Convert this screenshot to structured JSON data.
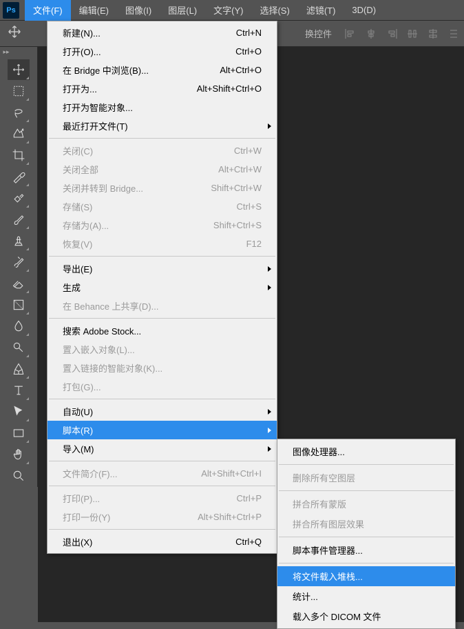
{
  "app_icon": "Ps",
  "menubar": {
    "items": [
      {
        "label": "文件(F)",
        "active": true
      },
      {
        "label": "编辑(E)"
      },
      {
        "label": "图像(I)"
      },
      {
        "label": "图层(L)"
      },
      {
        "label": "文字(Y)"
      },
      {
        "label": "选择(S)"
      },
      {
        "label": "滤镜(T)"
      },
      {
        "label": "3D(D)"
      }
    ]
  },
  "options": {
    "transform_label": "换控件"
  },
  "file_menu": {
    "groups": [
      [
        {
          "label": "新建(N)...",
          "shortcut": "Ctrl+N"
        },
        {
          "label": "打开(O)...",
          "shortcut": "Ctrl+O"
        },
        {
          "label": "在 Bridge 中浏览(B)...",
          "shortcut": "Alt+Ctrl+O"
        },
        {
          "label": "打开为...",
          "shortcut": "Alt+Shift+Ctrl+O"
        },
        {
          "label": "打开为智能对象..."
        },
        {
          "label": "最近打开文件(T)",
          "submenu": true
        }
      ],
      [
        {
          "label": "关闭(C)",
          "shortcut": "Ctrl+W",
          "disabled": true
        },
        {
          "label": "关闭全部",
          "shortcut": "Alt+Ctrl+W",
          "disabled": true
        },
        {
          "label": "关闭并转到 Bridge...",
          "shortcut": "Shift+Ctrl+W",
          "disabled": true
        },
        {
          "label": "存储(S)",
          "shortcut": "Ctrl+S",
          "disabled": true
        },
        {
          "label": "存储为(A)...",
          "shortcut": "Shift+Ctrl+S",
          "disabled": true
        },
        {
          "label": "恢复(V)",
          "shortcut": "F12",
          "disabled": true
        }
      ],
      [
        {
          "label": "导出(E)",
          "submenu": true
        },
        {
          "label": "生成",
          "submenu": true
        },
        {
          "label": "在 Behance 上共享(D)...",
          "disabled": true
        }
      ],
      [
        {
          "label": "搜索 Adobe Stock..."
        },
        {
          "label": "置入嵌入对象(L)...",
          "disabled": true
        },
        {
          "label": "置入链接的智能对象(K)...",
          "disabled": true
        },
        {
          "label": "打包(G)...",
          "disabled": true
        }
      ],
      [
        {
          "label": "自动(U)",
          "submenu": true
        },
        {
          "label": "脚本(R)",
          "submenu": true,
          "highlight": true
        },
        {
          "label": "导入(M)",
          "submenu": true
        }
      ],
      [
        {
          "label": "文件简介(F)...",
          "shortcut": "Alt+Shift+Ctrl+I",
          "disabled": true
        }
      ],
      [
        {
          "label": "打印(P)...",
          "shortcut": "Ctrl+P",
          "disabled": true
        },
        {
          "label": "打印一份(Y)",
          "shortcut": "Alt+Shift+Ctrl+P",
          "disabled": true
        }
      ],
      [
        {
          "label": "退出(X)",
          "shortcut": "Ctrl+Q"
        }
      ]
    ]
  },
  "script_submenu": {
    "groups": [
      [
        {
          "label": "图像处理器..."
        }
      ],
      [
        {
          "label": "删除所有空图层",
          "disabled": true
        }
      ],
      [
        {
          "label": "拼合所有蒙版",
          "disabled": true
        },
        {
          "label": "拼合所有图层效果",
          "disabled": true
        }
      ],
      [
        {
          "label": "脚本事件管理器..."
        }
      ],
      [
        {
          "label": "将文件载入堆栈...",
          "highlight": true
        },
        {
          "label": "统计..."
        },
        {
          "label": "载入多个 DICOM 文件"
        }
      ]
    ]
  }
}
